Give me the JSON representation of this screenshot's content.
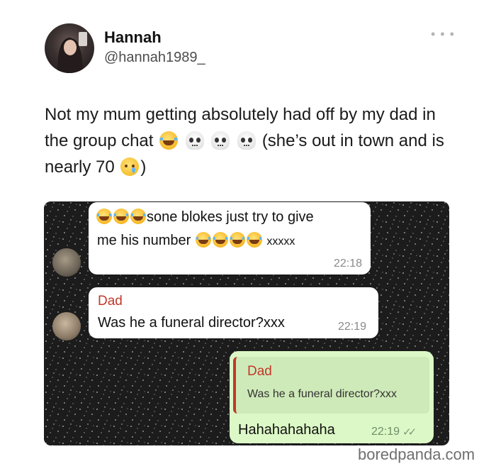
{
  "tweet": {
    "author_name": "Hannah",
    "author_handle": "@hannah1989_",
    "more_icon": "more-horizontal-icon",
    "text_part1": "Not my mum getting absolutely had off by my dad in the group chat",
    "text_part2": "(she’s out in town and is nearly 70",
    "text_part3": ")"
  },
  "chat": {
    "messages": [
      {
        "text_line1": "sone blokes just try to give",
        "text_line2": "me his number",
        "text_suffix": "xxxxx",
        "time": "22:18"
      },
      {
        "sender": "Dad",
        "text": "Was he a funeral director?xxx",
        "time": "22:19"
      },
      {
        "quoted_sender": "Dad",
        "quoted_text": "Was he a funeral director?xxx",
        "text": "Hahahahahaha",
        "time": "22:19",
        "status_icon": "double-check-icon"
      }
    ]
  },
  "watermark": "boredpanda.com",
  "colors": {
    "sender_name": "#c0392b",
    "outgoing_bubble": "#dcf8c6",
    "incoming_bubble": "#ffffff"
  }
}
